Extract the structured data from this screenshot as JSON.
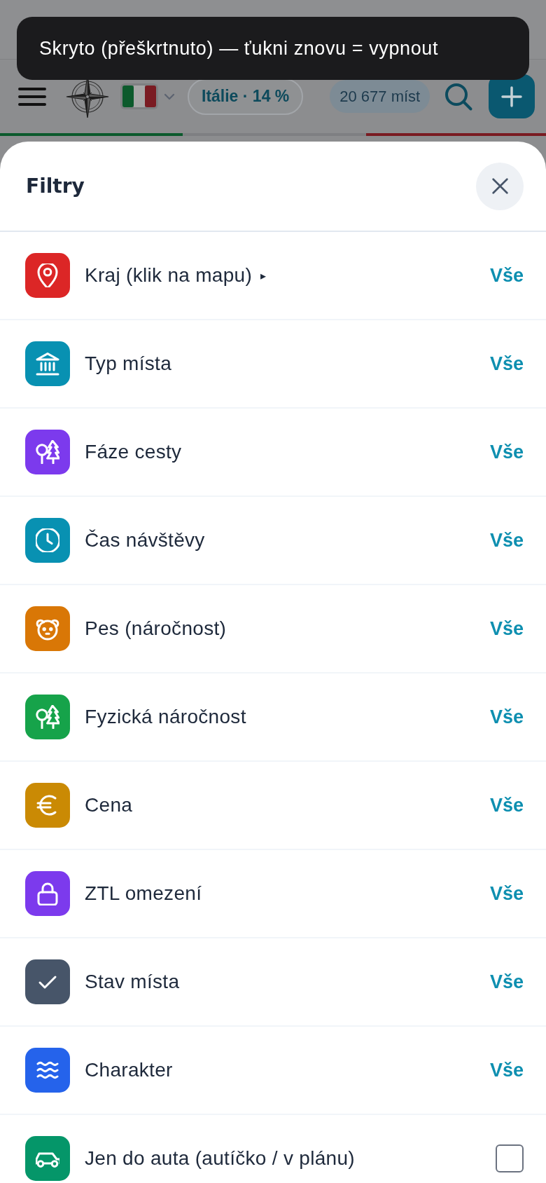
{
  "toast": {
    "text": "Skryto (přeškrtnuto) — ťukni znovu = vypnout"
  },
  "top_bar": {
    "country_pill": "Itálie · 14 %",
    "count_pill": "20 677 míst"
  },
  "sheet": {
    "title": "Filtry",
    "filters": [
      {
        "kind": "choice",
        "color": "#dc2626",
        "label": "Kraj (klik na mapu)",
        "arrow": "▸",
        "value": "Vše"
      },
      {
        "kind": "choice",
        "color": "#0891b2",
        "label": "Typ místa",
        "value": "Vše"
      },
      {
        "kind": "choice",
        "color": "#7c3aed",
        "label": "Fáze cesty",
        "value": "Vše"
      },
      {
        "kind": "choice",
        "color": "#0891b2",
        "label": "Čas návštěvy",
        "value": "Vše"
      },
      {
        "kind": "choice",
        "color": "#d97706",
        "label": "Pes (náročnost)",
        "value": "Vše"
      },
      {
        "kind": "choice",
        "color": "#16a34a",
        "label": "Fyzická náročnost",
        "value": "Vše"
      },
      {
        "kind": "choice",
        "color": "#ca8a04",
        "label": "Cena",
        "value": "Vše"
      },
      {
        "kind": "choice",
        "color": "#7c3aed",
        "label": "ZTL omezení",
        "value": "Vše"
      },
      {
        "kind": "choice",
        "color": "#475569",
        "label": "Stav místa",
        "value": "Vše"
      },
      {
        "kind": "choice",
        "color": "#2563eb",
        "label": "Charakter",
        "value": "Vše"
      },
      {
        "kind": "toggle",
        "color": "#059669",
        "label": "Jen do auta (autíčko / v plánu)",
        "checked": false
      }
    ]
  }
}
